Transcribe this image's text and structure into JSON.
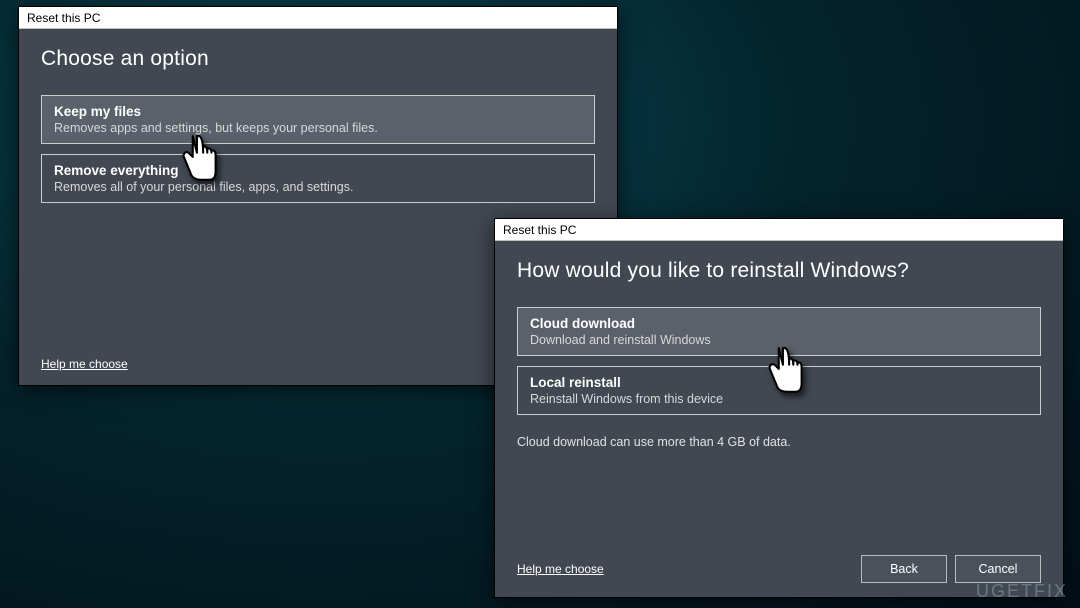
{
  "watermark": "UGETFIX",
  "window1": {
    "title": "Reset this PC",
    "heading": "Choose an option",
    "options": [
      {
        "title": "Keep my files",
        "subtitle": "Removes apps and settings, but keeps your personal files.",
        "selected": true
      },
      {
        "title": "Remove everything",
        "subtitle": "Removes all of your personal files, apps, and settings.",
        "selected": false
      }
    ],
    "help": "Help me choose"
  },
  "window2": {
    "title": "Reset this PC",
    "heading": "How would you like to reinstall Windows?",
    "options": [
      {
        "title": "Cloud download",
        "subtitle": "Download and reinstall Windows",
        "selected": true
      },
      {
        "title": "Local reinstall",
        "subtitle": "Reinstall Windows from this device",
        "selected": false
      }
    ],
    "note": "Cloud download can use more than 4 GB of data.",
    "help": "Help me choose",
    "buttons": {
      "back": "Back",
      "cancel": "Cancel"
    }
  }
}
